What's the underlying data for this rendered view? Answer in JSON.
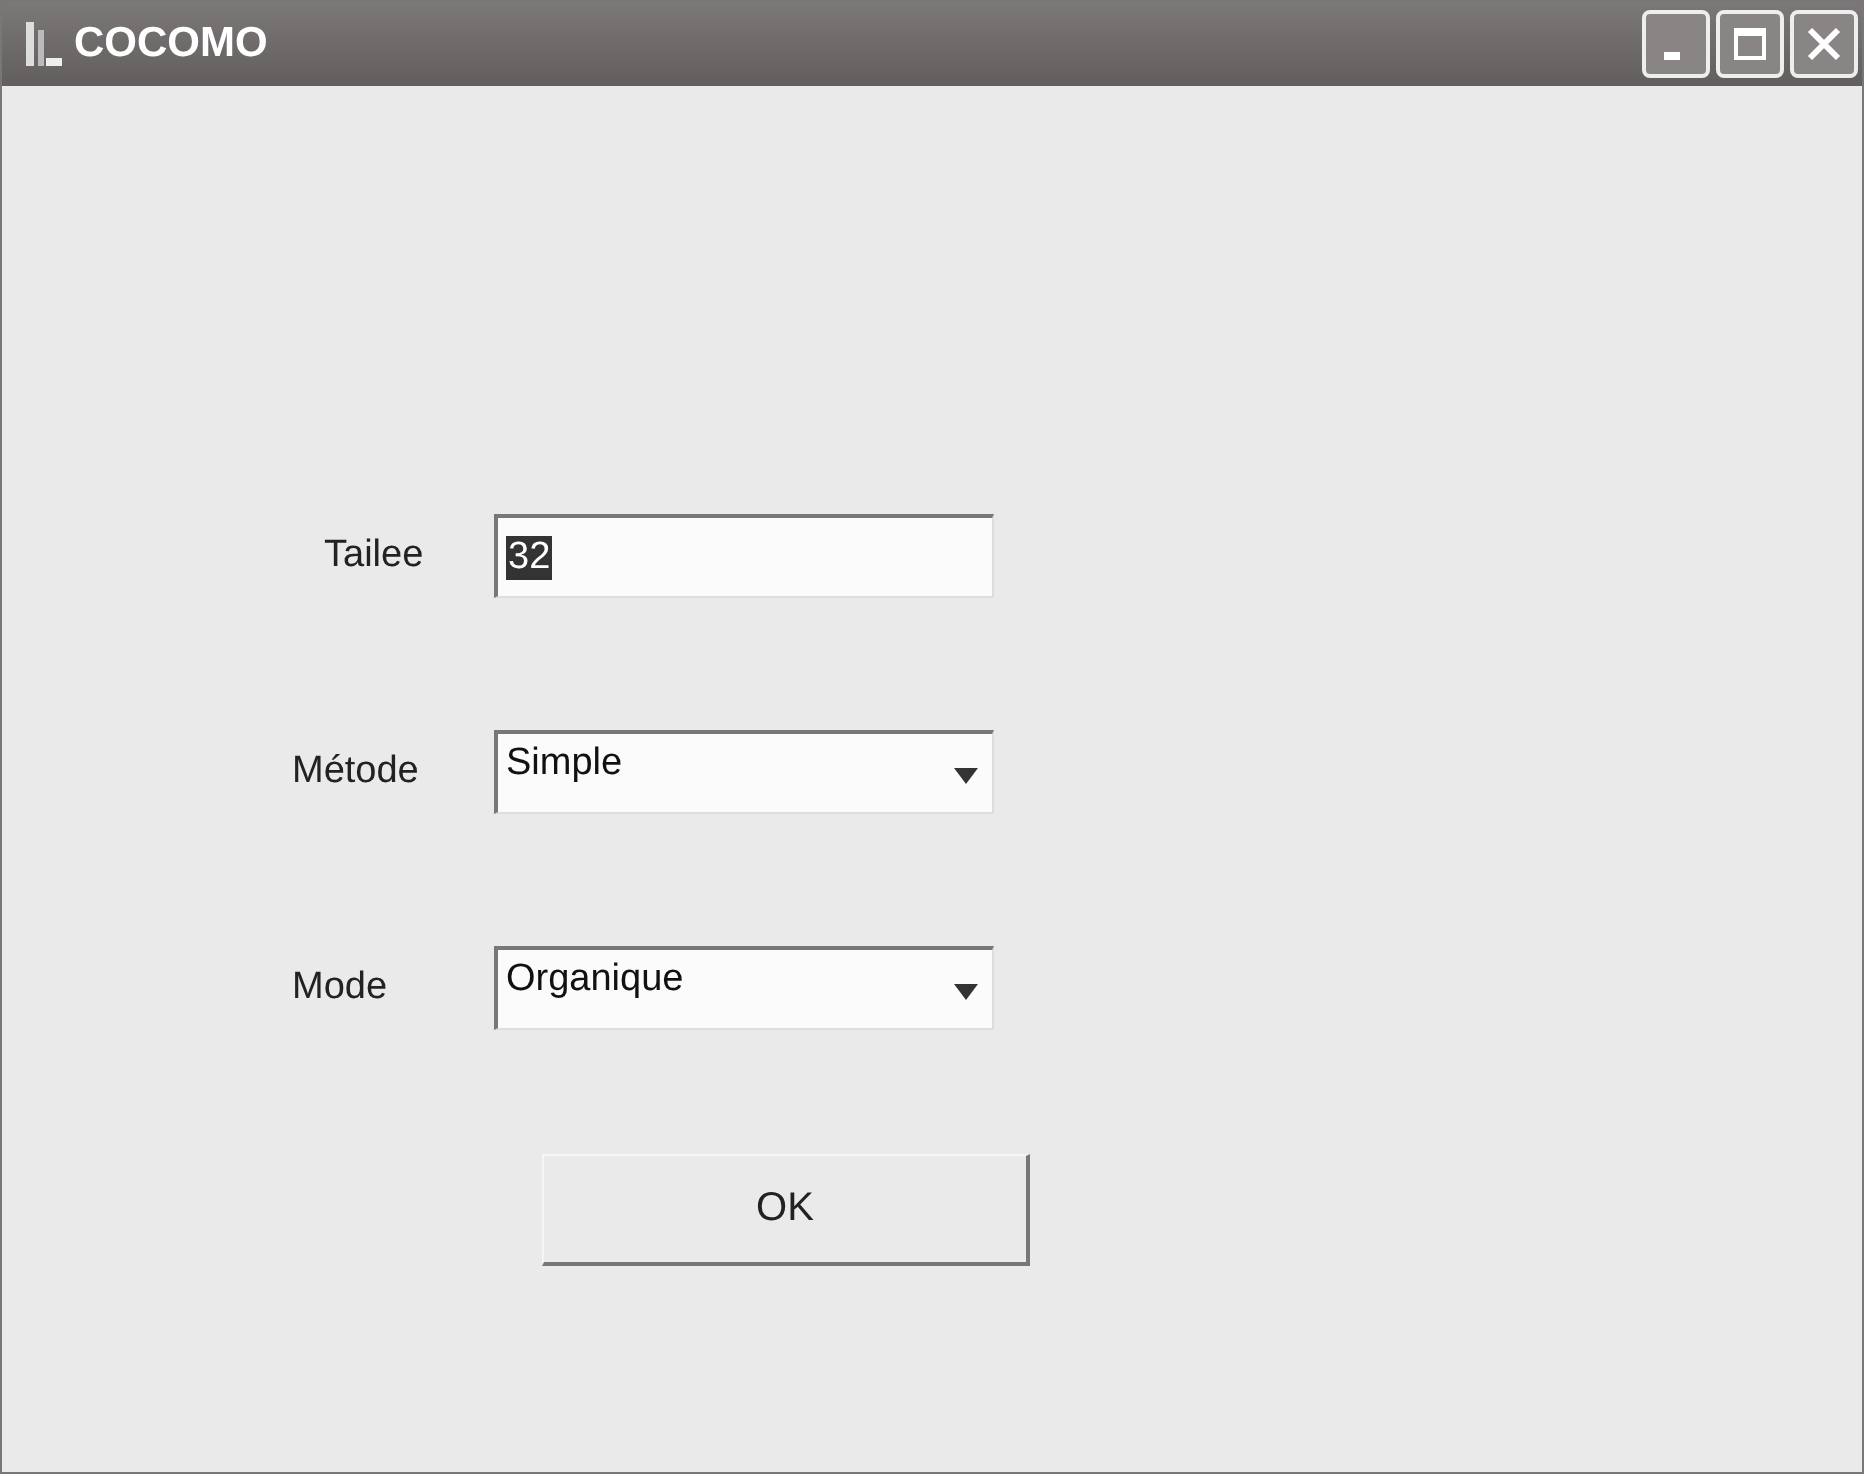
{
  "window": {
    "title": "COCOMO"
  },
  "fields": [
    {
      "kind": "text",
      "label": "Tailee",
      "value": "32",
      "text_selected": true
    },
    {
      "kind": "dropdown",
      "label": "Métode",
      "value": "Simple"
    },
    {
      "kind": "dropdown",
      "label": "Mode",
      "value": "Organique"
    }
  ],
  "buttons": [
    "OK"
  ]
}
